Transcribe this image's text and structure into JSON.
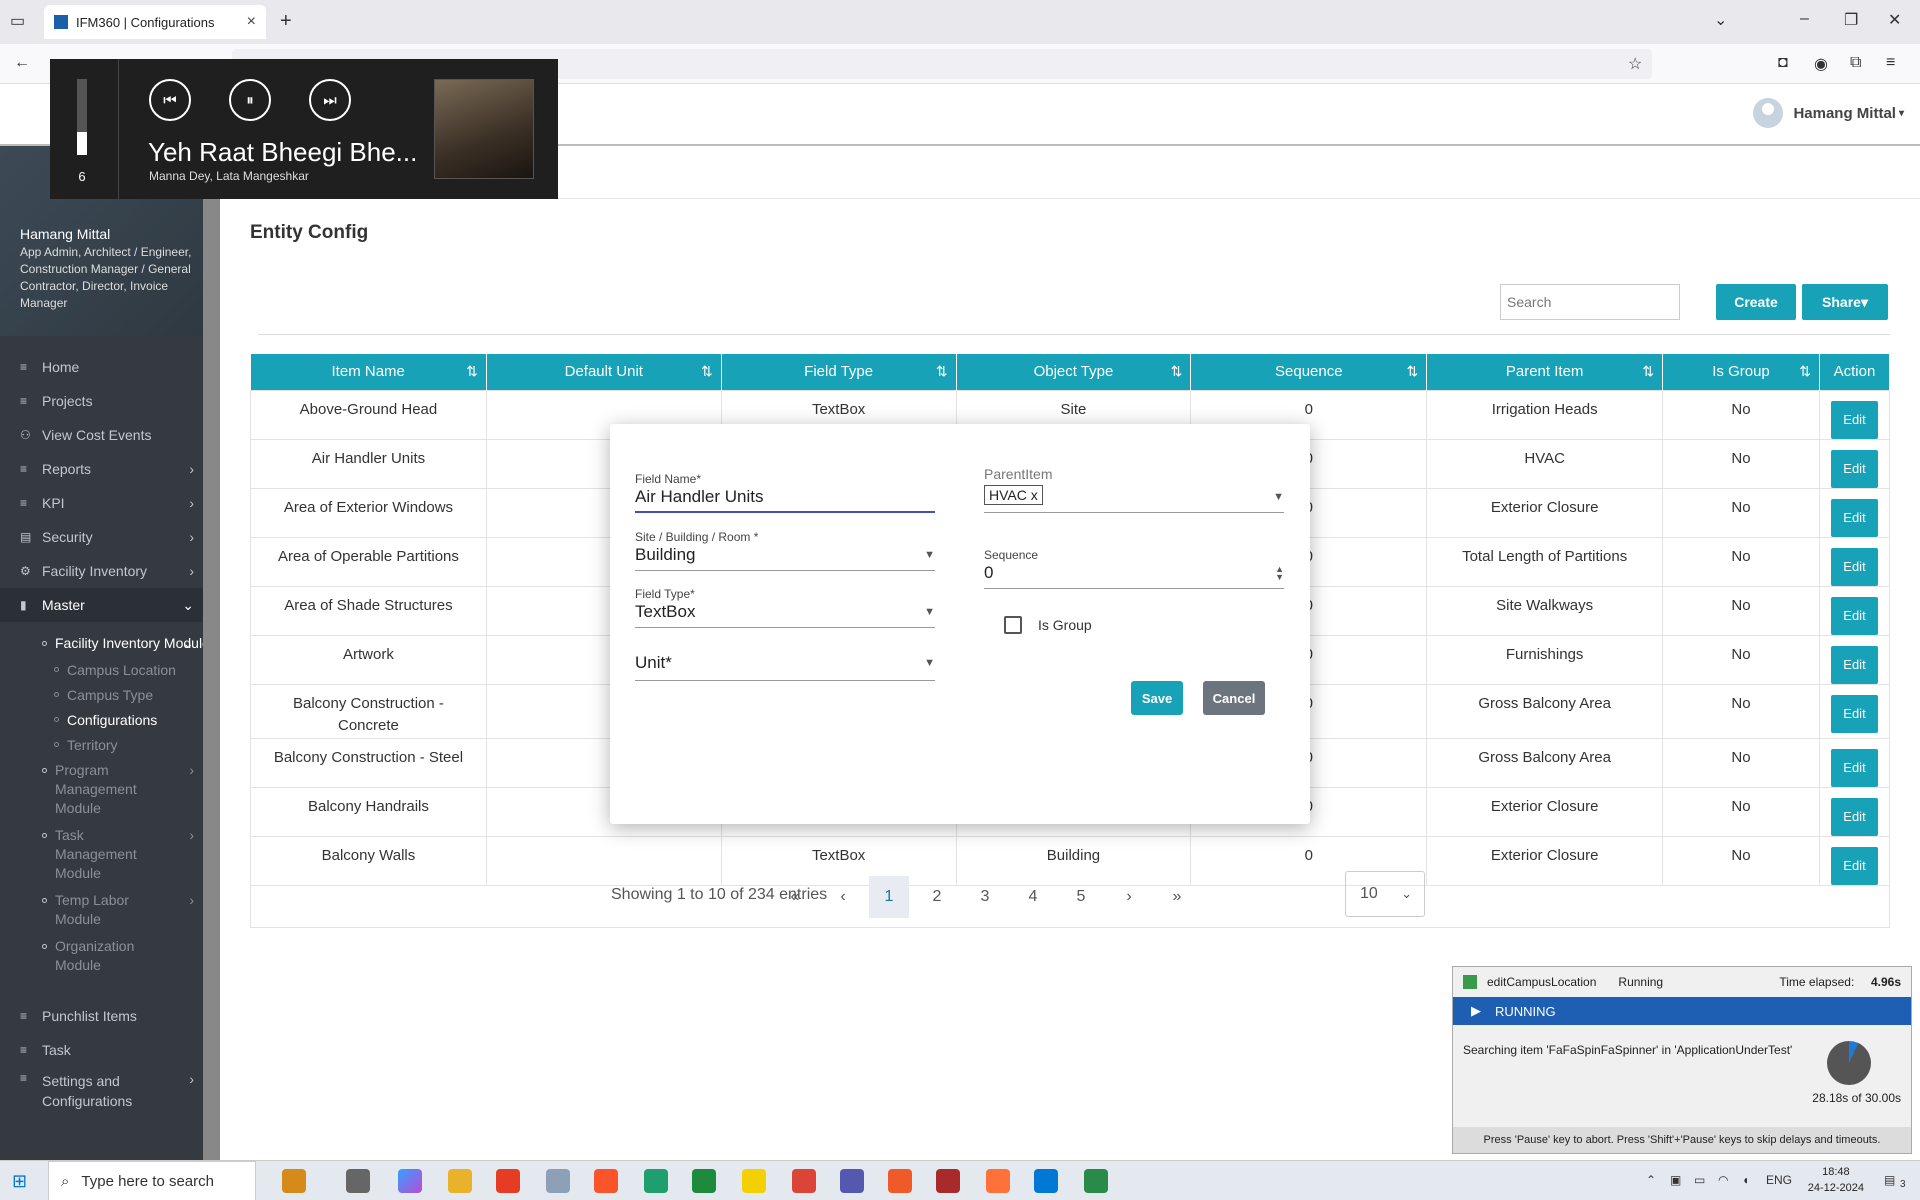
{
  "browser": {
    "tab_title": "IFM360 | Configurations",
    "new_tab": "+"
  },
  "header": {
    "user_name": "Hamang Mittal"
  },
  "sidebar": {
    "profile_name": "Hamang Mittal",
    "profile_roles": "App Admin, Architect / Engineer, Construction Manager / General Contractor, Director, Invoice Manager",
    "items": [
      {
        "label": "Home",
        "icon": "≡"
      },
      {
        "label": "Projects",
        "icon": "≡"
      },
      {
        "label": "View Cost Events",
        "icon": "⚇"
      },
      {
        "label": "Reports",
        "icon": "≡",
        "arrow": "›"
      },
      {
        "label": "KPI",
        "icon": "≡",
        "arrow": "›"
      },
      {
        "label": "Security",
        "icon": "▤",
        "arrow": "›"
      },
      {
        "label": "Facility Inventory",
        "icon": "⚙",
        "arrow": "›"
      },
      {
        "label": "Master",
        "icon": "▮",
        "arrow": "⌄"
      }
    ],
    "facility_module": "Facility Inventory Module",
    "facility_children": [
      "Campus Location",
      "Campus Type",
      "Configurations",
      "Territory"
    ],
    "modules": [
      "Program Management Module",
      "Task Management Module",
      "Temp Labor Module",
      "Organization Module"
    ],
    "bottom_items": [
      {
        "label": "Punchlist Items",
        "icon": "≡"
      },
      {
        "label": "Task",
        "icon": "≡"
      },
      {
        "label": "Settings and Configurations",
        "icon": "≡",
        "arrow": "›"
      }
    ]
  },
  "main": {
    "page_title": "Entity Config",
    "search_placeholder": "Search",
    "create_label": "Create",
    "share_label": "Share▾",
    "columns": [
      "Item Name",
      "Default Unit",
      "Field Type",
      "Object Type",
      "Sequence",
      "Parent Item",
      "Is Group",
      "Action"
    ],
    "rows": [
      {
        "name": "Above-Ground Head",
        "unit": "",
        "field": "TextBox",
        "object": "Site",
        "seq": "0",
        "parent": "Irrigation Heads",
        "group": "No"
      },
      {
        "name": "Air Handler Units",
        "unit": "",
        "field": "",
        "object": "",
        "seq": "0",
        "parent": "HVAC",
        "group": "No"
      },
      {
        "name": "Area of Exterior Windows",
        "unit": "",
        "field": "",
        "object": "",
        "seq": "0",
        "parent": "Exterior Closure",
        "group": "No"
      },
      {
        "name": "Area of Operable Partitions",
        "unit": "",
        "field": "",
        "object": "",
        "seq": "0",
        "parent": "Total Length of Partitions",
        "group": "No"
      },
      {
        "name": "Area of Shade Structures",
        "unit": "",
        "field": "",
        "object": "",
        "seq": "0",
        "parent": "Site Walkways",
        "group": "No"
      },
      {
        "name": "Artwork",
        "unit": "",
        "field": "",
        "object": "",
        "seq": "0",
        "parent": "Furnishings",
        "group": "No"
      },
      {
        "name": "Balcony Construction - Concrete",
        "unit": "",
        "field": "",
        "object": "",
        "seq": "0",
        "parent": "Gross Balcony Area",
        "group": "No"
      },
      {
        "name": "Balcony Construction - Steel",
        "unit": "",
        "field": "",
        "object": "",
        "seq": "0",
        "parent": "Gross Balcony Area",
        "group": "No"
      },
      {
        "name": "Balcony Handrails",
        "unit": "",
        "field": "",
        "object": "",
        "seq": "0",
        "parent": "Exterior Closure",
        "group": "No"
      },
      {
        "name": "Balcony Walls",
        "unit": "",
        "field": "TextBox",
        "object": "Building",
        "seq": "0",
        "parent": "Exterior Closure",
        "group": "No"
      }
    ],
    "edit_label": "Edit",
    "entries_text": "Showing 1 to 10 of 234 entries",
    "pages": [
      "«",
      "‹",
      "1",
      "2",
      "3",
      "4",
      "5",
      "›",
      "»"
    ],
    "per_page": "10"
  },
  "modal": {
    "field_name_label": "Field Name*",
    "field_name_value": "Air Handler Units",
    "site_label": "Site / Building / Room *",
    "site_value": "Building",
    "field_type_label": "Field Type*",
    "field_type_value": "TextBox",
    "unit_label": "Unit*",
    "parent_label": "ParentItem",
    "parent_chip": "HVAC x",
    "sequence_label": "Sequence",
    "sequence_value": "0",
    "is_group_label": "Is Group",
    "save_label": "Save",
    "cancel_label": "Cancel"
  },
  "media": {
    "volume": "6",
    "volume_level": 0.3,
    "title": "Yeh Raat Bheegi Bhe...",
    "artist": "Manna Dey, Lata Mangeshkar"
  },
  "runner": {
    "test_name": "editCampusLocation",
    "state": "Running",
    "elapsed_label": "Time elapsed:",
    "elapsed_value": "4.96s",
    "status_bar": "RUNNING",
    "message": "Searching item 'FaFaSpinFaSpinner' in 'ApplicationUnderTest'",
    "progress_time": "28.18s of 30.00s",
    "footer": "Press 'Pause' key to abort. Press 'Shift'+'Pause' keys to skip delays and timeouts."
  },
  "taskbar": {
    "search_placeholder": "Type here to search",
    "language": "ENG",
    "time": "18:48",
    "date": "24-12-2024",
    "notification_count": "3"
  },
  "colors": {
    "accent": "#17a2b8",
    "sidebar": "#343a40",
    "save": "#17a2b8",
    "cancel": "#6c757d"
  }
}
